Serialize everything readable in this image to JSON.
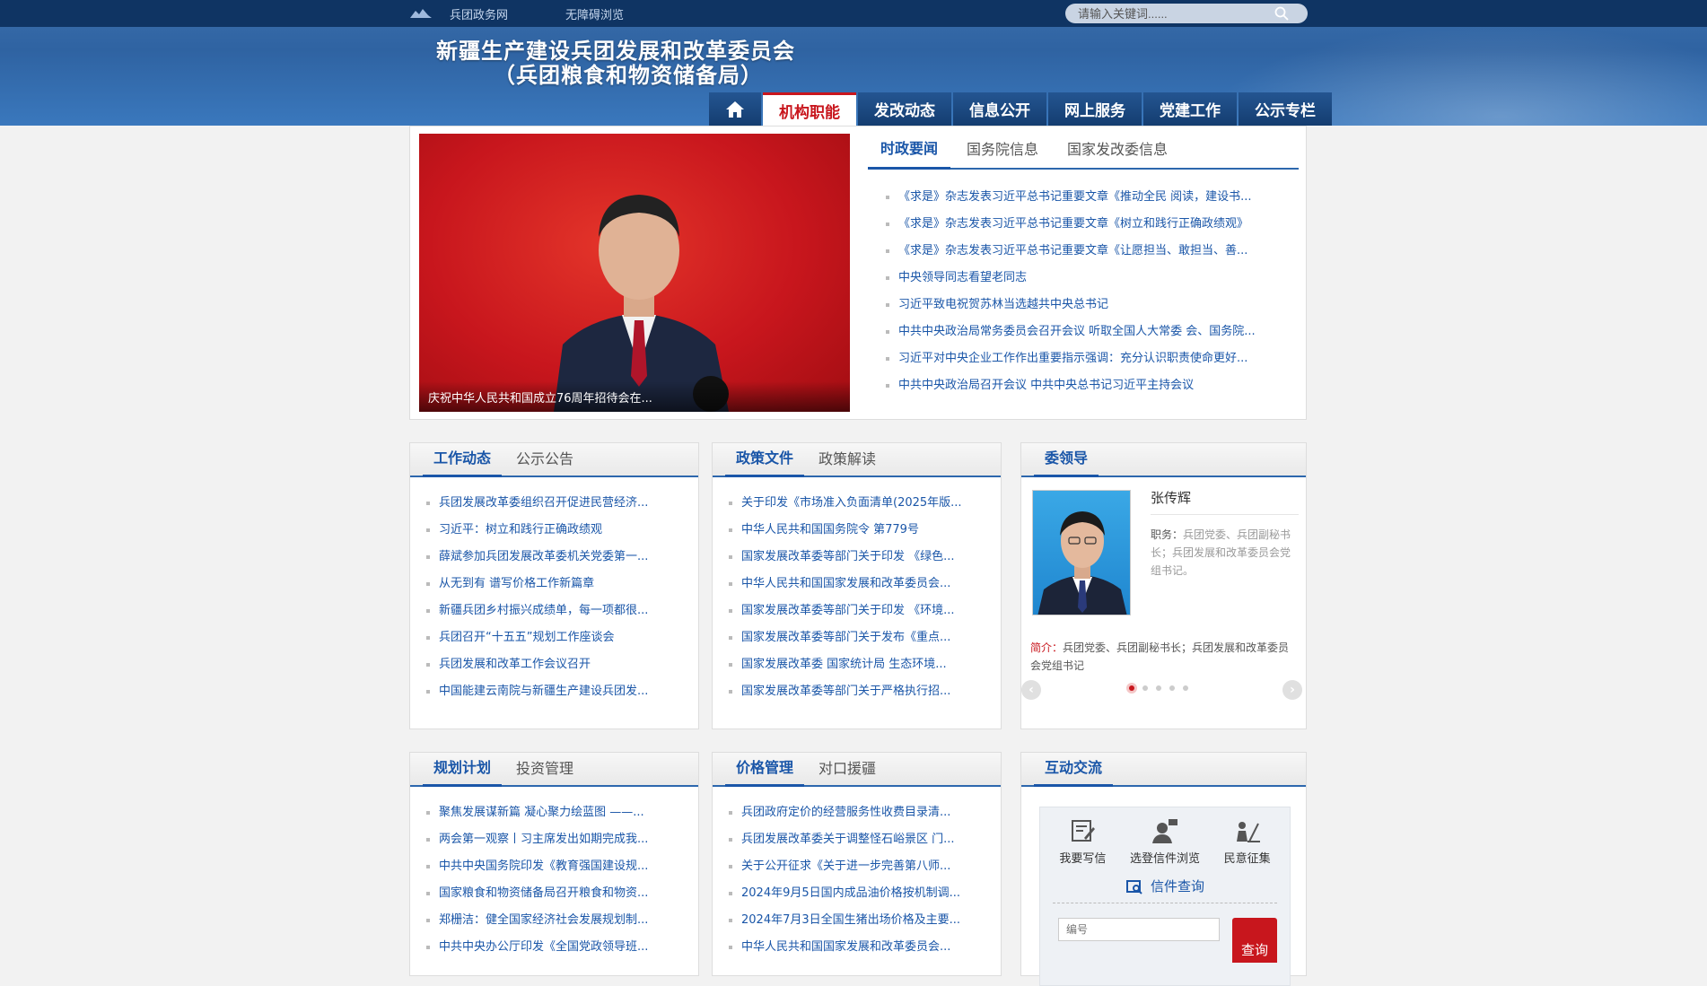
{
  "topbar": {
    "links": [
      "兵团政务网",
      "无障碍浏览"
    ],
    "search_placeholder": "请输入关键词......"
  },
  "site": {
    "title_line1": "新疆生产建设兵团发展和改革委员会",
    "title_line2": "（兵团粮食和物资储备局）"
  },
  "nav": {
    "items": [
      "机构职能",
      "发改动态",
      "信息公开",
      "网上服务",
      "党建工作",
      "公示专栏"
    ],
    "active": "机构职能"
  },
  "featured": {
    "caption": "庆祝中华人民共和国成立76周年招待会在..."
  },
  "news": {
    "tabs": [
      "时政要闻",
      "国务院信息",
      "国家发改委信息"
    ],
    "items": [
      "《求是》杂志发表习近平总书记重要文章《推动全民 阅读，建设书...",
      "《求是》杂志发表习近平总书记重要文章《树立和践行正确政绩观》",
      "《求是》杂志发表习近平总书记重要文章《让愿担当、敢担当、善...",
      "中央领导同志看望老同志",
      "习近平致电祝贺苏林当选越共中央总书记",
      "中共中央政治局常务委员会召开会议 听取全国人大常委 会、国务院...",
      "习近平对中央企业工作作出重要指示强调：充分认识职责使命更好...",
      "中共中央政治局召开会议 中共中央总书记习近平主持会议"
    ]
  },
  "work": {
    "tabs": [
      "工作动态",
      "公示公告"
    ],
    "items": [
      "兵团发展改革委组织召开促进民营经济...",
      "习近平：树立和践行正确政绩观",
      "薛斌参加兵团发展改革委机关党委第一...",
      "从无到有 谱写价格工作新篇章",
      "新疆兵团乡村振兴成绩单，每一项都很...",
      "兵团召开“十五五”规划工作座谈会",
      "兵团发展和改革工作会议召开",
      "中国能建云南院与新疆生产建设兵团发..."
    ]
  },
  "policy": {
    "tabs": [
      "政策文件",
      "政策解读"
    ],
    "items": [
      "关于印发《市场准入负面清单(2025年版...",
      "中华人民共和国国务院令  第779号",
      "国家发展改革委等部门关于印发 《绿色...",
      "中华人民共和国国家发展和改革委员会...",
      "国家发展改革委等部门关于印发 《环境...",
      "国家发展改革委等部门关于发布《重点...",
      "国家发展改革委 国家统计局 生态环境...",
      "国家发展改革委等部门关于严格执行招..."
    ]
  },
  "leader": {
    "tabs": [
      "委领导"
    ],
    "name": "张传辉",
    "duty_label": "职务：",
    "duty": "兵团党委、兵团副秘书长；兵团发展和改革委员会党组书记。",
    "intro_label": "简介：",
    "intro": "兵团党委、兵团副秘书长；兵团发展和改革委员会党组书记"
  },
  "plan": {
    "tabs": [
      "规划计划",
      "投资管理"
    ],
    "items": [
      "聚焦发展谋新篇 凝心聚力绘蓝图 ——...",
      "两会第一观察丨习主席发出如期完成我...",
      "中共中央国务院印发《教育强国建设规...",
      "国家粮食和物资储备局召开粮食和物资...",
      "郑栅洁：健全国家经济社会发展规划制...",
      "中共中央办公厅印发《全国党政领导班..."
    ]
  },
  "price": {
    "tabs": [
      "价格管理",
      "对口援疆"
    ],
    "items": [
      "兵团政府定价的经营服务性收费目录清...",
      "兵团发展改革委关于调整怪石峪景区 门...",
      "关于公开征求《关于进一步完善第八师...",
      "2024年9月5日国内成品油价格按机制调...",
      "2024年7月3日全国生猪出场价格及主要...",
      "中华人民共和国国家发展和改革委员会..."
    ]
  },
  "interact": {
    "tabs": [
      "互动交流"
    ],
    "buttons": [
      "我要写信",
      "选登信件浏览",
      "民意征集"
    ],
    "letter_query": "信件查询",
    "code_placeholder": "编号",
    "query_button": "查询"
  },
  "colors": {
    "brand_blue": "#1a56a8",
    "accent_red": "#c8161d",
    "header_dark": "#0f3463"
  }
}
